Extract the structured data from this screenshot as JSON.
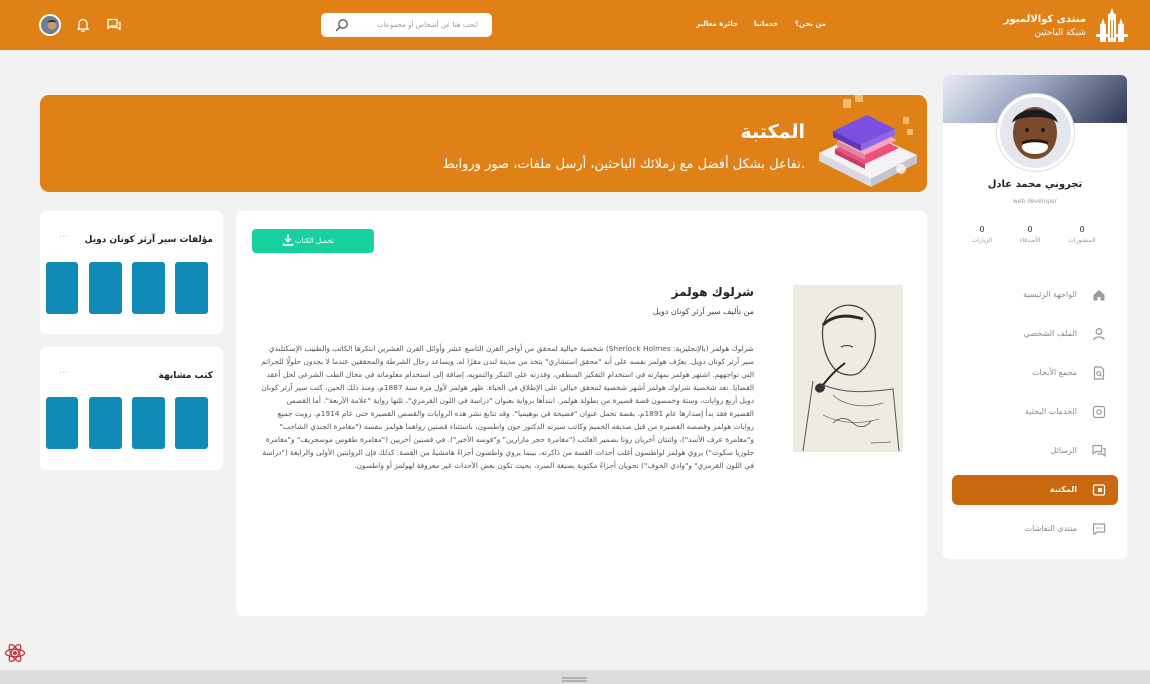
{
  "header": {
    "brand_line1": "منتدى كوالالمبور",
    "brand_line2": "شبكة الباحثين",
    "nav": {
      "about": "من نحن؟",
      "services": "خدماتنا",
      "award": "جائزة معالير"
    },
    "search_placeholder": "ابحث هنا عن أشخاص أو مجموعات"
  },
  "hero": {
    "title": "المكتبة",
    "subtitle": "تفاعل بشكل أفضل مع زملائك الباحثين، أرسل ملفات، صور وروابط."
  },
  "profile": {
    "name": "تجروني محمد عادل",
    "role": "web developer",
    "stats": [
      {
        "value": "0",
        "label": "المنشورات"
      },
      {
        "value": "0",
        "label": "الأصدقاء"
      },
      {
        "value": "0",
        "label": "الزيارات"
      }
    ]
  },
  "menu": [
    {
      "label": "الواجهة الرئيسية",
      "icon": "home-icon"
    },
    {
      "label": "الملف الشخصي",
      "icon": "user-icon"
    },
    {
      "label": "مجمع الأبحاث",
      "icon": "document-search-icon"
    },
    {
      "label": "الخدمات البحثية",
      "icon": "settings-icon"
    },
    {
      "label": "الرسائل",
      "icon": "messages-icon"
    },
    {
      "label": "المكتبة",
      "icon": "library-icon",
      "active": true
    },
    {
      "label": "منتدى النقاشات",
      "icon": "forum-icon"
    }
  ],
  "book": {
    "download_label": "تحميل الكتاب",
    "title": "شرلوك هولمز",
    "author": "من تأليف سير آرثر كونان دويل",
    "description": "شرلوك هولمز (بالإنجليزية: Sherlock Holmes) شخصية خيالية لمحقق من أواخر القرن التاسع عشر وأوائل القرن العشرين ابتكرها الكاتب والطبيب الإسكتلندي سير آرثر كونان دويل. يعرّف هولمز نفسه على أنه \"محقق استشاري\" يتخذ من مدينة لندن مقرًا له، ويساعد رجال الشرطة والمحققين عندما لا يجدون حلولًا للجرائم التي تواجههم. اشتهر هولمز بمهارته في استخدام التفكير المنطقي، وقدرته على التنكر والتمويه، إضافة إلى استخدام معلوماته في مجال الطب الشرعي لحل أعقد القضايا. تعد شخصية شرلوك هولمز أشهر شخصية لمحقق خيالي على الإطلاق في الحياة. ظهر هولمز لأول مرة سنة 1887م، ومنذ ذلك الحين، كتب سير آرثر كونان دويل أربع روايات، وستة وخمسون قصة قصيرة من بطولة هولمز. ابتدأها برواية بعنوان \"دراسة في اللون القرمزي\"، تلتها رواية \"علامة الأربعة\". أما القصص القصيرة فقد بدأ إصدارها عام 1891م، بقصة تحمل عنوان \"فضيحة في بوهيميا\". وقد تتابع نشر هذه الروايات والقصص القصيرة حتى عام 1914م. رويت جميع روايات هولمز وقصصه القصيرة من قبل صديقه الحميم وكاتب سيرته الدكتور جون واطسون، باستثناء قصتين رواهما هولمز بنفسه (\"مغامرة الجندي الشاحب\" و\"مغامرة عرف الأسد\")، واثنتان أخريان روتا بضمير الغائب (\"مغامرة حجر مازارين\" و\"قوسه الأخير\"). في قصتين أخريين (\"مغامرة طقوس موسجريف\" و\"مغامرة جلوريا سكوت\") يروي هولمز لواطسون أغلب أحداث القصة من ذاكرته، بينما يروي واطسون أجزاءً هامشيةً من القصة. كذلك فإن الروايتين الأولى والرابعة (\"دراسة في اللون القرمزي\" و\"وادي الخوف\") تحويان أجزاءً مكتوبة بصيغة السرد، بحيث تكون بعض الأحداث غير معروفة لهولمز أو واطسون."
  },
  "side": {
    "author_books_title": "مؤلفات سير آرثر كونان دويل",
    "similar_books_title": "كتب مشابهة",
    "more": "···"
  },
  "colors": {
    "brand_orange": "#df8116",
    "active_menu": "#c8680f",
    "download_green": "#18d1a0",
    "book_thumb_blue": "#0f8bb6"
  }
}
